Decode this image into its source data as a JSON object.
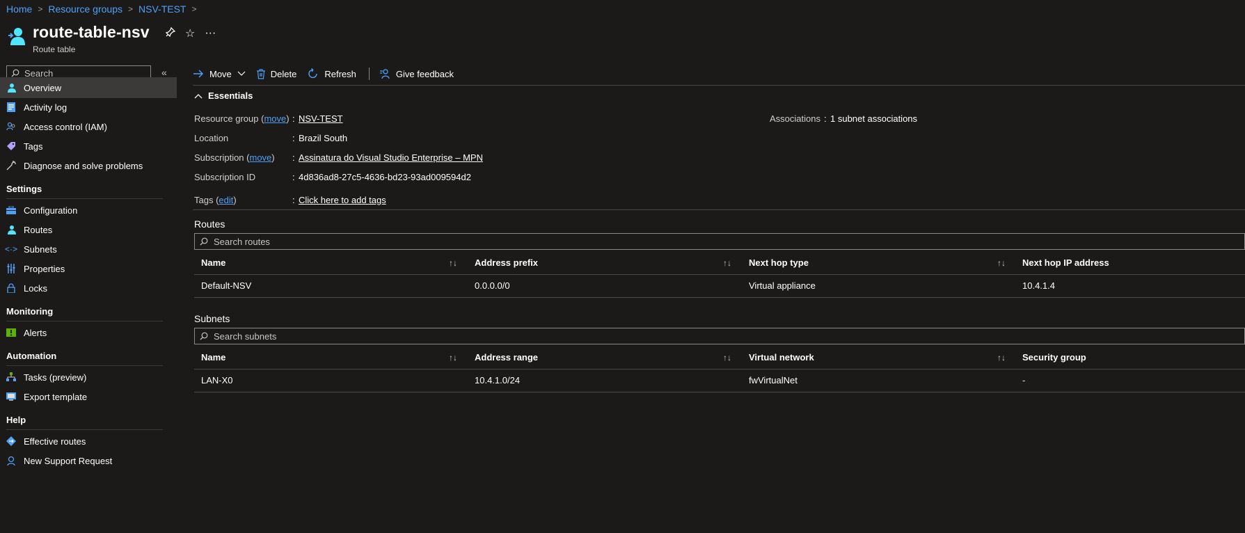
{
  "breadcrumb": [
    {
      "label": "Home"
    },
    {
      "label": "Resource groups"
    },
    {
      "label": "NSV-TEST"
    }
  ],
  "resource": {
    "title": "route-table-nsv",
    "subtitle": "Route table",
    "more_label": "···"
  },
  "sidebar": {
    "search_placeholder": "Search",
    "collapse_label": "«",
    "items": [
      {
        "label": "Overview",
        "icon": "route-table-icon",
        "active": true
      },
      {
        "label": "Activity log",
        "icon": "activity-log-icon"
      },
      {
        "label": "Access control (IAM)",
        "icon": "people-icon"
      },
      {
        "label": "Tags",
        "icon": "tag-icon"
      },
      {
        "label": "Diagnose and solve problems",
        "icon": "wrench-icon"
      }
    ],
    "sections": [
      {
        "title": "Settings",
        "items": [
          {
            "label": "Configuration",
            "icon": "toolbox-icon"
          },
          {
            "label": "Routes",
            "icon": "route-icon"
          },
          {
            "label": "Subnets",
            "icon": "code-brackets-icon"
          },
          {
            "label": "Properties",
            "icon": "sliders-icon"
          },
          {
            "label": "Locks",
            "icon": "lock-icon"
          }
        ]
      },
      {
        "title": "Monitoring",
        "items": [
          {
            "label": "Alerts",
            "icon": "alert-icon"
          }
        ]
      },
      {
        "title": "Automation",
        "items": [
          {
            "label": "Tasks (preview)",
            "icon": "tasks-icon"
          },
          {
            "label": "Export template",
            "icon": "export-template-icon"
          }
        ]
      },
      {
        "title": "Help",
        "items": [
          {
            "label": "Effective routes",
            "icon": "effective-routes-icon"
          },
          {
            "label": "New Support Request",
            "icon": "support-icon"
          }
        ]
      }
    ]
  },
  "toolbar": {
    "move_label": "Move",
    "delete_label": "Delete",
    "refresh_label": "Refresh",
    "feedback_label": "Give feedback"
  },
  "essentials": {
    "heading": "Essentials",
    "resource_group_label": "Resource group",
    "move_link": "move",
    "resource_group_value": "NSV-TEST",
    "location_label": "Location",
    "location_value": "Brazil South",
    "subscription_label": "Subscription",
    "subscription_value": "Assinatura do Visual Studio Enterprise – MPN",
    "subscription_id_label": "Subscription ID",
    "subscription_id_value": "4d836ad8-27c5-4636-bd23-93ad009594d2",
    "tags_label": "Tags",
    "edit_link": "edit",
    "tags_value": "Click here to add tags",
    "associations_label": "Associations",
    "associations_value": "1 subnet associations",
    "colon": ":"
  },
  "routes": {
    "title": "Routes",
    "search_placeholder": "Search routes",
    "columns": [
      "Name",
      "Address prefix",
      "Next hop type",
      "Next hop IP address"
    ],
    "rows": [
      [
        "Default-NSV",
        "0.0.0.0/0",
        "Virtual appliance",
        "10.4.1.4"
      ]
    ]
  },
  "subnets": {
    "title": "Subnets",
    "search_placeholder": "Search subnets",
    "columns": [
      "Name",
      "Address range",
      "Virtual network",
      "Security group"
    ],
    "rows": [
      [
        "LAN-X0",
        "10.4.1.0/24",
        "fwVirtualNet",
        "-"
      ]
    ]
  },
  "sort_glyph": "↑↓",
  "colors": {
    "background": "#1b1a19",
    "link": "#4ea1f7",
    "active_item": "#3b3a39",
    "accent_icon": "#50e6ff"
  }
}
